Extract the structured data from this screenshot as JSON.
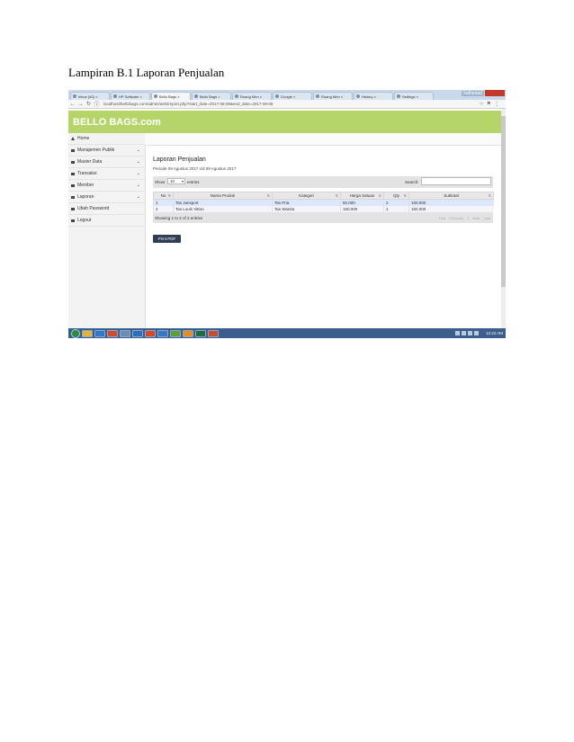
{
  "caption": "Lampiran B.1 Laporan Penjualan",
  "browser": {
    "tabs": [
      {
        "label": "Inbox (60) ×"
      },
      {
        "label": "HP Software ×"
      },
      {
        "label": "Bello Bags ×",
        "active": true
      },
      {
        "label": "Bello Bags ×"
      },
      {
        "label": "Ruang Men ×"
      },
      {
        "label": "Google ×"
      },
      {
        "label": "Ruang Men ×"
      },
      {
        "label": "History ×"
      },
      {
        "label": "Settings ×"
      }
    ],
    "user_badge": "katheaad",
    "url": "localhost/bellobags.com/admin/web/report.php?start_date=2017-08-09&end_date=2017-08-09"
  },
  "app": {
    "brand": "BELLO BAGS.com",
    "sidebar": [
      {
        "label": "Home",
        "icon": "home-icon",
        "chevron": false
      },
      {
        "label": "Manajemen Publik",
        "icon": "menu-icon",
        "chevron": true
      },
      {
        "label": "Master Data",
        "icon": "menu-icon",
        "chevron": true
      },
      {
        "label": "Transaksi",
        "icon": "menu-icon",
        "chevron": true
      },
      {
        "label": "Member",
        "icon": "menu-icon",
        "chevron": true
      },
      {
        "label": "Laporan",
        "icon": "menu-icon",
        "chevron": true
      },
      {
        "label": "Ubah Password",
        "icon": "menu-icon",
        "chevron": false
      },
      {
        "label": "Logout",
        "icon": "menu-icon",
        "chevron": false
      }
    ],
    "report": {
      "title": "Laporan Penjualan",
      "period": "Periode 09 Agustus 2017 s/d 09 Agustus 2017",
      "show_label": "Show",
      "show_value": "10",
      "entries_label": "entries",
      "search_label": "Search:",
      "columns": [
        "No",
        "Nama Produk",
        "Kategori",
        "Harga Satuan",
        "Qty",
        "Subtotal"
      ],
      "rows": [
        [
          "1",
          "Tas Jansport",
          "Tas Pria",
          "50.000",
          "2",
          "100.000"
        ],
        [
          "2",
          "Tas Louis Vitton",
          "Tas Wanita",
          "150.000",
          "1",
          "150.000"
        ]
      ],
      "info": "Showing 1 to 2 of 2 entries",
      "pager": [
        "First",
        "Previous",
        "1",
        "Next",
        "Last"
      ],
      "print_label": "Print PDF"
    }
  },
  "taskbar": {
    "clock": "12:22 AM"
  }
}
